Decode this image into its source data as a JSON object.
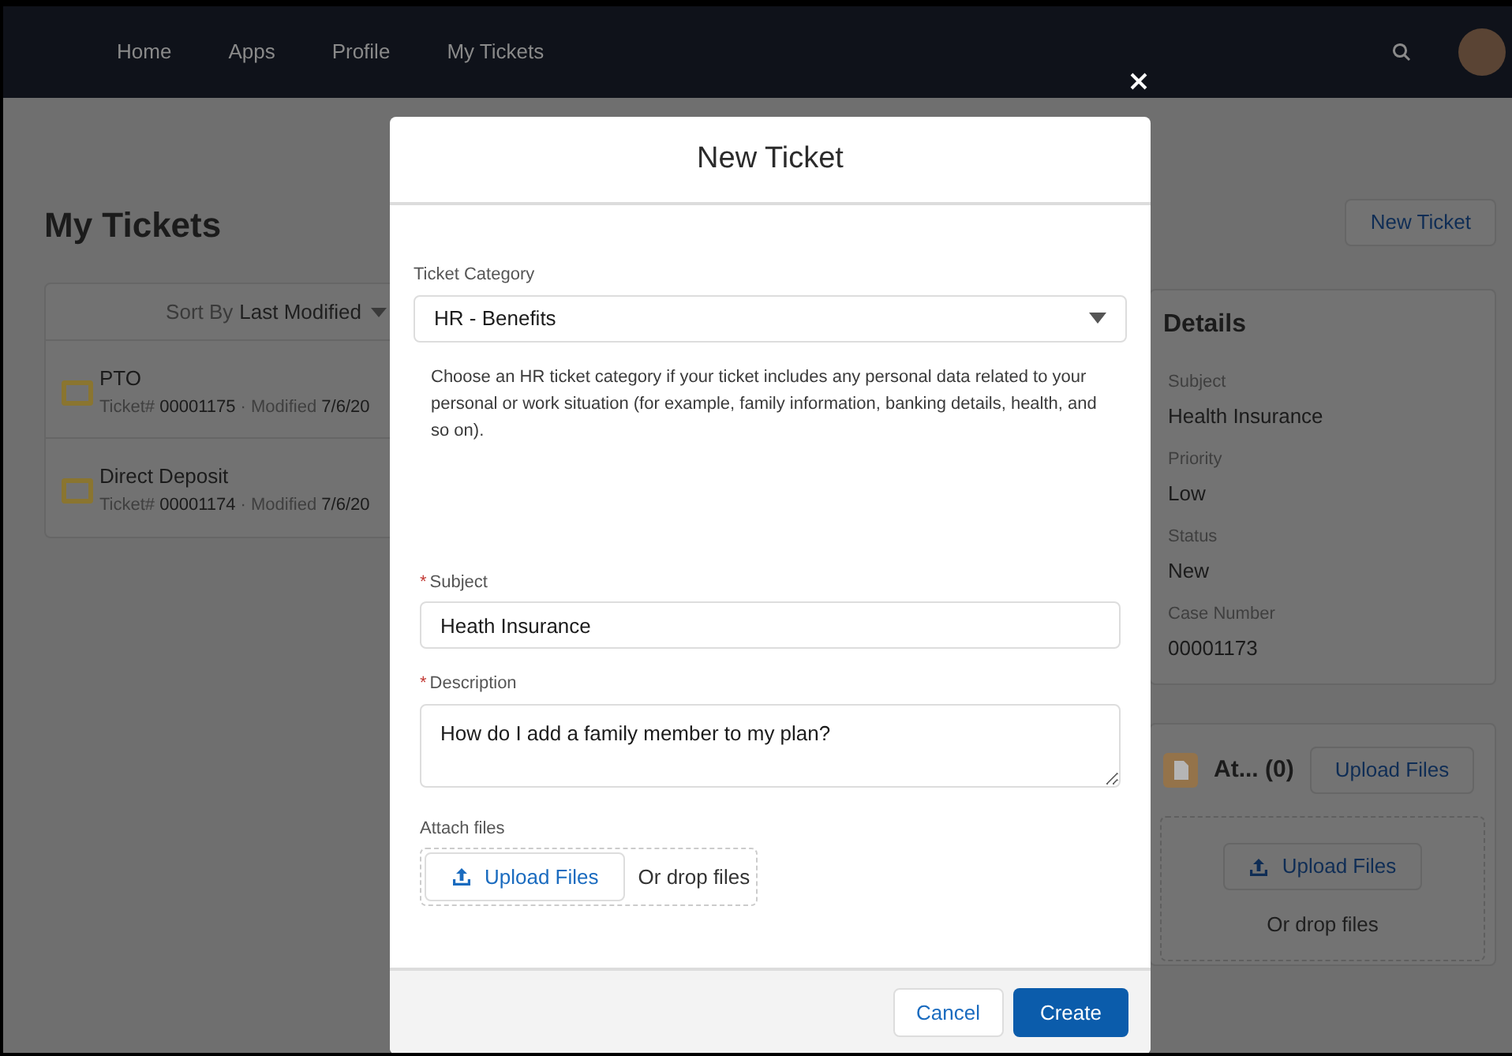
{
  "nav": {
    "items": [
      {
        "label": "Home"
      },
      {
        "label": "Apps"
      },
      {
        "label": "Profile"
      },
      {
        "label": "My Tickets"
      }
    ]
  },
  "page": {
    "title": "My Tickets",
    "new_ticket_button": "New Ticket",
    "list": {
      "sort_label": "Sort By",
      "sort_value": "Last Modified",
      "tickets": [
        {
          "title": "PTO",
          "meta": "Ticket# **00001175** · Modified **7/6/20**"
        },
        {
          "title": "Direct Deposit",
          "meta": "Ticket# **00001174** · Modified **7/6/20**"
        }
      ]
    },
    "details": {
      "heading": "Details",
      "fields": [
        {
          "label": "Subject",
          "value": "Health Insurance"
        },
        {
          "label": "Priority",
          "value": "Low"
        },
        {
          "label": "Status",
          "value": "New"
        },
        {
          "label": "Case Number",
          "value": "00001173"
        }
      ]
    },
    "attachments": {
      "title": "At... (0)",
      "upload_button": "Upload Files",
      "drop_button": "Upload Files",
      "drop_text": "Or drop files"
    }
  },
  "modal": {
    "title": "New Ticket",
    "category": {
      "label": "Ticket Category",
      "value": "HR - Benefits",
      "help": "Choose an HR ticket category if your ticket includes any personal data related to your personal or work situation (for example, family information, banking details, health, and so on)."
    },
    "subject": {
      "label": "Subject",
      "required_mark": "*",
      "value": "Heath Insurance"
    },
    "description": {
      "label": "Description",
      "required_mark": "*",
      "value": "How do I add a family member to my plan?"
    },
    "attach": {
      "label": "Attach files",
      "button": "Upload Files",
      "drop_text": "Or drop files"
    },
    "buttons": {
      "cancel": "Cancel",
      "create": "Create"
    }
  }
}
